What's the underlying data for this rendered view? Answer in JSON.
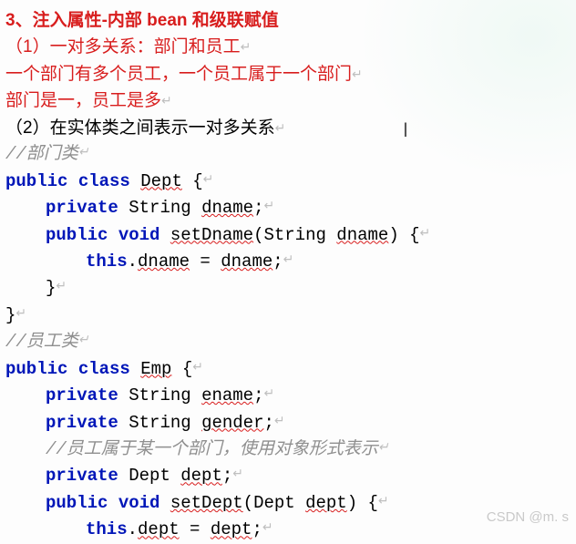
{
  "title": "3、注入属性-内部 bean 和级联赋值",
  "line1": "（1）一对多关系：部门和员工",
  "line2": "一个部门有多个员工，一个员工属于一个部门",
  "line3": "部门是一，员工是多",
  "line4_prefix": "（2）",
  "line4_text": "在实体类之间表示一对多关系",
  "comments": {
    "dept": "//部门类",
    "emp": "//员工类",
    "emp_inner": "//员工属于某一个部门，使用对象形式表示"
  },
  "code": {
    "kw_public": "public",
    "kw_class": "class",
    "kw_private": "private",
    "kw_void": "void",
    "kw_this": "this",
    "type_string": "String",
    "type_dept": "Dept",
    "class_dept": "Dept",
    "class_emp": "Emp",
    "field_dname": "dname",
    "field_ename": "ename",
    "field_gender": "gender",
    "field_dept": "dept",
    "method_setDname": "setDname",
    "method_setDept": "setDept",
    "param_dname": "dname",
    "param_dept": "dept",
    "eq": " = ",
    "semi": ";",
    "lbrace": "{",
    "rbrace": "}",
    "lparen": "(",
    "rparen": ")",
    "dot": ".",
    "sp": " "
  },
  "marks": {
    "para": "↵",
    "cursor": "I"
  },
  "watermark": "CSDN @m. s"
}
